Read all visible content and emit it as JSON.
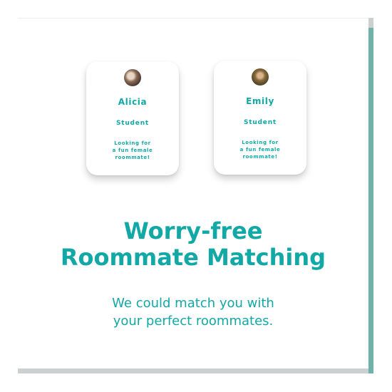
{
  "profiles": [
    {
      "name": "Alicia",
      "role": "Student",
      "description_line1": "Looking for",
      "description_line2": "a fun female",
      "description_line3": "roommate!"
    },
    {
      "name": "Emily",
      "role": "Student",
      "description_line1": "Looking for",
      "description_line2": "a fun female",
      "description_line3": "roommate!"
    }
  ],
  "headline": {
    "line1": "Worry-free",
    "line2": "Roommate Matching"
  },
  "subline": {
    "line1": "We could match you with",
    "line2": "your perfect roommates."
  },
  "colors": {
    "accent": "#12a8a5",
    "shadow_block": "#6fb3a8",
    "gray_strip": "#cdd0d0",
    "background": "#ffffff"
  }
}
